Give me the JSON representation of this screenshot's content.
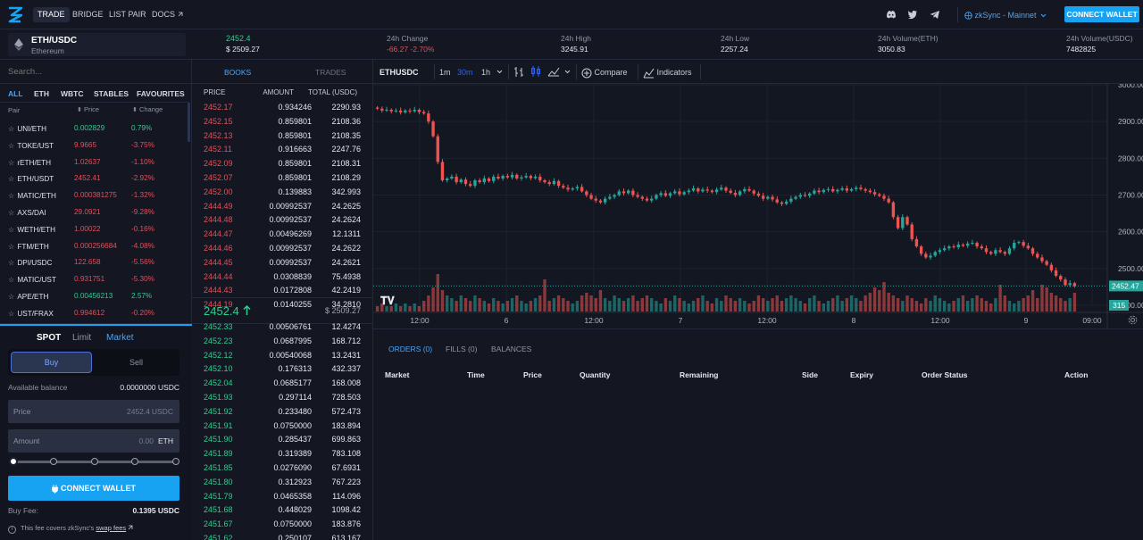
{
  "nav": {
    "links": [
      "TRADE",
      "BRIDGE",
      "LIST PAIR",
      "DOCS"
    ],
    "network": "zkSync - Mainnet",
    "connect_wallet": "CONNECT WALLET"
  },
  "ticker": {
    "pair": "ETH/USDC",
    "pair_sub": "Ethereum",
    "last_price": "2452.4",
    "last_price_usd": "$ 2509.27",
    "change_label": "24h Change",
    "change_value": "-66.27 -2.70%",
    "high_label": "24h High",
    "high_value": "3245.91",
    "low_label": "24h Low",
    "low_value": "2257.24",
    "vol_eth_label": "24h Volume(ETH)",
    "vol_eth_value": "3050.83",
    "vol_usdc_label": "24h Volume(USDC)",
    "vol_usdc_value": "7482825"
  },
  "markets": {
    "search_placeholder": "Search...",
    "filters": [
      "ALL",
      "ETH",
      "WBTC",
      "STABLES",
      "FAVOURITES"
    ],
    "col_pair": "Pair",
    "col_price": "Price",
    "col_change": "Change",
    "rows": [
      {
        "pair": "UNI/ETH",
        "price": "0.002829",
        "change": "0.79%",
        "up": true
      },
      {
        "pair": "TOKE/UST",
        "price": "9.9665",
        "change": "-3.75%",
        "up": false
      },
      {
        "pair": "rETH/ETH",
        "price": "1.02637",
        "change": "-1.10%",
        "up": false
      },
      {
        "pair": "ETH/USDT",
        "price": "2452.41",
        "change": "-2.92%",
        "up": false
      },
      {
        "pair": "MATIC/ETH",
        "price": "0.000381275",
        "change": "-1.32%",
        "up": false
      },
      {
        "pair": "AXS/DAI",
        "price": "29.0921",
        "change": "-9.28%",
        "up": false
      },
      {
        "pair": "WETH/ETH",
        "price": "1.00022",
        "change": "-0.16%",
        "up": false
      },
      {
        "pair": "FTM/ETH",
        "price": "0.000256684",
        "change": "-4.08%",
        "up": false
      },
      {
        "pair": "DPI/USDC",
        "price": "122.658",
        "change": "-5.56%",
        "up": false
      },
      {
        "pair": "MATIC/UST",
        "price": "0.931751",
        "change": "-5.30%",
        "up": false
      },
      {
        "pair": "APE/ETH",
        "price": "0.00456213",
        "change": "2.57%",
        "up": true
      },
      {
        "pair": "UST/FRAX",
        "price": "0.994612",
        "change": "-0.20%",
        "up": false
      }
    ]
  },
  "form": {
    "tabs": [
      "SPOT",
      "Limit",
      "Market"
    ],
    "buy": "Buy",
    "sell": "Sell",
    "balance_label": "Available balance",
    "balance_value": "0.0000000 USDC",
    "price_label": "Price",
    "price_value": "2452.4",
    "price_unit": "USDC",
    "amount_label": "Amount",
    "amount_value": "0.00",
    "amount_unit": "ETH",
    "slider_percent": 0,
    "connect": "CONNECT WALLET",
    "fee_label": "Buy Fee:",
    "fee_value": "0.1395 USDC",
    "fee_note": "This fee covers zkSync's",
    "fee_link": "swap fees"
  },
  "book": {
    "tabs": [
      "BOOKS",
      "TRADES"
    ],
    "col_price": "PRICE",
    "col_amount": "AMOUNT",
    "col_total": "TOTAL (USDC)",
    "asks": [
      [
        "2452.17",
        "0.934246",
        "2290.93"
      ],
      [
        "2452.15",
        "0.859801",
        "2108.36"
      ],
      [
        "2452.13",
        "0.859801",
        "2108.35"
      ],
      [
        "2452.11",
        "0.916663",
        "2247.76"
      ],
      [
        "2452.09",
        "0.859801",
        "2108.31"
      ],
      [
        "2452.07",
        "0.859801",
        "2108.29"
      ],
      [
        "2452.00",
        "0.139883",
        "342.993"
      ],
      [
        "2444.49",
        "0.00992537",
        "24.2625"
      ],
      [
        "2444.48",
        "0.00992537",
        "24.2624"
      ],
      [
        "2444.47",
        "0.00496269",
        "12.1311"
      ],
      [
        "2444.46",
        "0.00992537",
        "24.2622"
      ],
      [
        "2444.45",
        "0.00992537",
        "24.2621"
      ],
      [
        "2444.44",
        "0.0308839",
        "75.4938"
      ],
      [
        "2444.43",
        "0.0172808",
        "42.2419"
      ],
      [
        "2444.19",
        "0.0140255",
        "34.2810"
      ]
    ],
    "mid_price": "2452.4",
    "mid_usd": "$ 2509.27",
    "bids": [
      [
        "2452.33",
        "0.00506761",
        "12.4274"
      ],
      [
        "2452.23",
        "0.0687995",
        "168.712"
      ],
      [
        "2452.12",
        "0.00540068",
        "13.2431"
      ],
      [
        "2452.10",
        "0.176313",
        "432.337"
      ],
      [
        "2452.04",
        "0.0685177",
        "168.008"
      ],
      [
        "2451.93",
        "0.297114",
        "728.503"
      ],
      [
        "2451.92",
        "0.233480",
        "572.473"
      ],
      [
        "2451.91",
        "0.0750000",
        "183.894"
      ],
      [
        "2451.90",
        "0.285437",
        "699.863"
      ],
      [
        "2451.89",
        "0.319389",
        "783.108"
      ],
      [
        "2451.85",
        "0.0276090",
        "67.6931"
      ],
      [
        "2451.80",
        "0.312923",
        "767.223"
      ],
      [
        "2451.79",
        "0.0465358",
        "114.096"
      ],
      [
        "2451.68",
        "0.448029",
        "1098.42"
      ],
      [
        "2451.67",
        "0.0750000",
        "183.876"
      ],
      [
        "2451.62",
        "0.250107",
        "613.167"
      ]
    ]
  },
  "chart_toolbar": {
    "symbol": "ETHUSDC",
    "intervals": [
      "1m",
      "30m",
      "1h"
    ],
    "compare": "Compare",
    "indicators": "Indicators"
  },
  "chart_data": {
    "type": "candlestick",
    "y_ticks": [
      "3000.00",
      "2900.00",
      "2800.00",
      "2700.00",
      "2600.00",
      "2500.00",
      "2400.00"
    ],
    "x_ticks": [
      "12:00",
      "6",
      "12:00",
      "7",
      "12:00",
      "8",
      "12:00",
      "9",
      "09:00"
    ],
    "ylim": [
      2400,
      3000
    ],
    "last_price": "2452.47",
    "last_volume": "315",
    "close_series": [
      2935,
      2930,
      2932,
      2928,
      2930,
      2925,
      2930,
      2928,
      2932,
      2926,
      2922,
      2900,
      2860,
      2790,
      2740,
      2745,
      2750,
      2735,
      2742,
      2730,
      2725,
      2740,
      2735,
      2745,
      2738,
      2750,
      2745,
      2752,
      2748,
      2755,
      2745,
      2748,
      2752,
      2746,
      2750,
      2740,
      2735,
      2730,
      2738,
      2725,
      2720,
      2715,
      2718,
      2722,
      2710,
      2700,
      2690,
      2685,
      2680,
      2690,
      2695,
      2700,
      2710,
      2705,
      2712,
      2700,
      2695,
      2690,
      2685,
      2690,
      2700,
      2705,
      2698,
      2705,
      2710,
      2702,
      2708,
      2712,
      2718,
      2710,
      2715,
      2712,
      2708,
      2715,
      2720,
      2712,
      2706,
      2700,
      2710,
      2716,
      2712,
      2704,
      2698,
      2690,
      2695,
      2688,
      2680,
      2676,
      2682,
      2690,
      2695,
      2700,
      2698,
      2704,
      2712,
      2708,
      2714,
      2716,
      2710,
      2714,
      2718,
      2712,
      2716,
      2720,
      2716,
      2712,
      2708,
      2702,
      2698,
      2690,
      2680,
      2640,
      2610,
      2640,
      2620,
      2580,
      2560,
      2540,
      2530,
      2535,
      2545,
      2550,
      2555,
      2560,
      2558,
      2565,
      2562,
      2568,
      2570,
      2560,
      2555,
      2545,
      2540,
      2550,
      2545,
      2540,
      2555,
      2570,
      2572,
      2562,
      2555,
      2540,
      2530,
      2520,
      2510,
      2495,
      2480,
      2470,
      2455,
      2460,
      2452
    ],
    "volumes": [
      2,
      3,
      2,
      2,
      3,
      2,
      3,
      2,
      3,
      2,
      4,
      6,
      9,
      14,
      8,
      6,
      5,
      4,
      6,
      5,
      4,
      6,
      5,
      4,
      3,
      5,
      4,
      3,
      4,
      5,
      6,
      4,
      3,
      4,
      5,
      6,
      12,
      4,
      5,
      6,
      5,
      4,
      3,
      4,
      6,
      7,
      6,
      5,
      8,
      5,
      4,
      6,
      5,
      4,
      5,
      6,
      4,
      5,
      6,
      5,
      4,
      3,
      5,
      4,
      6,
      5,
      4,
      3,
      4,
      5,
      6,
      4,
      3,
      5,
      4,
      6,
      5,
      4,
      5,
      4,
      3,
      4,
      6,
      5,
      4,
      5,
      6,
      4,
      5,
      6,
      5,
      4,
      3,
      5,
      6,
      4,
      3,
      4,
      5,
      6,
      4,
      5,
      6,
      5,
      4,
      6,
      7,
      9,
      8,
      11,
      7,
      6,
      5,
      4,
      6,
      5,
      4,
      3,
      5,
      4,
      6,
      5,
      4,
      3,
      4,
      5,
      6,
      4,
      5,
      6,
      5,
      4,
      3,
      5,
      10,
      6,
      4,
      3,
      4,
      5,
      6,
      8,
      5,
      10,
      9,
      7,
      6,
      5,
      4,
      5,
      7
    ]
  },
  "orders": {
    "tabs": [
      "ORDERS (0)",
      "FILLS (0)",
      "BALANCES"
    ],
    "columns": [
      "Market",
      "Time",
      "Price",
      "Quantity",
      "Remaining",
      "Side",
      "Expiry",
      "Order Status",
      "Action"
    ]
  },
  "colors": {
    "accent": "#17a2f2",
    "up": "#2ecc8f",
    "down": "#e0505a",
    "candle_up": "#26a69a",
    "candle_down": "#ef5350"
  }
}
